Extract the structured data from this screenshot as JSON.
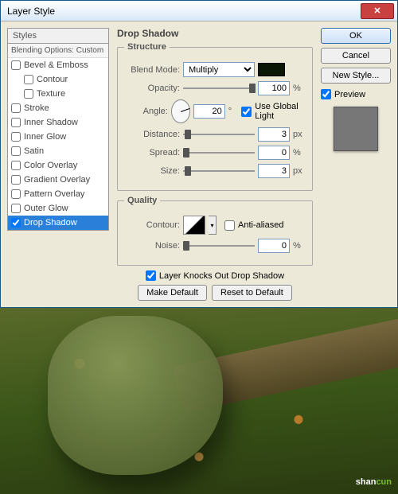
{
  "dialog": {
    "title": "Layer Style"
  },
  "styles": {
    "header": "Styles",
    "blending": "Blending Options: Custom",
    "items": [
      {
        "label": "Bevel & Emboss",
        "checked": false
      },
      {
        "label": "Contour",
        "checked": false,
        "sub": true
      },
      {
        "label": "Texture",
        "checked": false,
        "sub": true
      },
      {
        "label": "Stroke",
        "checked": false
      },
      {
        "label": "Inner Shadow",
        "checked": false
      },
      {
        "label": "Inner Glow",
        "checked": false
      },
      {
        "label": "Satin",
        "checked": false
      },
      {
        "label": "Color Overlay",
        "checked": false
      },
      {
        "label": "Gradient Overlay",
        "checked": false
      },
      {
        "label": "Pattern Overlay",
        "checked": false
      },
      {
        "label": "Outer Glow",
        "checked": false
      },
      {
        "label": "Drop Shadow",
        "checked": true,
        "active": true
      }
    ]
  },
  "panel": {
    "title": "Drop Shadow",
    "structure": {
      "legend": "Structure",
      "blendmode_label": "Blend Mode:",
      "blendmode_value": "Multiply",
      "opacity_label": "Opacity:",
      "opacity_value": "100",
      "opacity_unit": "%",
      "angle_label": "Angle:",
      "angle_value": "20",
      "angle_unit": "°",
      "global_label": "Use Global Light",
      "distance_label": "Distance:",
      "distance_value": "3",
      "distance_unit": "px",
      "spread_label": "Spread:",
      "spread_value": "0",
      "spread_unit": "%",
      "size_label": "Size:",
      "size_value": "3",
      "size_unit": "px"
    },
    "quality": {
      "legend": "Quality",
      "contour_label": "Contour:",
      "aa_label": "Anti-aliased",
      "noise_label": "Noise:",
      "noise_value": "0",
      "noise_unit": "%"
    },
    "knockout": "Layer Knocks Out Drop Shadow",
    "make_default": "Make Default",
    "reset_default": "Reset to Default"
  },
  "buttons": {
    "ok": "OK",
    "cancel": "Cancel",
    "newstyle": "New Style...",
    "preview": "Preview"
  },
  "watermark": {
    "a": "shan",
    "b": "cun"
  }
}
